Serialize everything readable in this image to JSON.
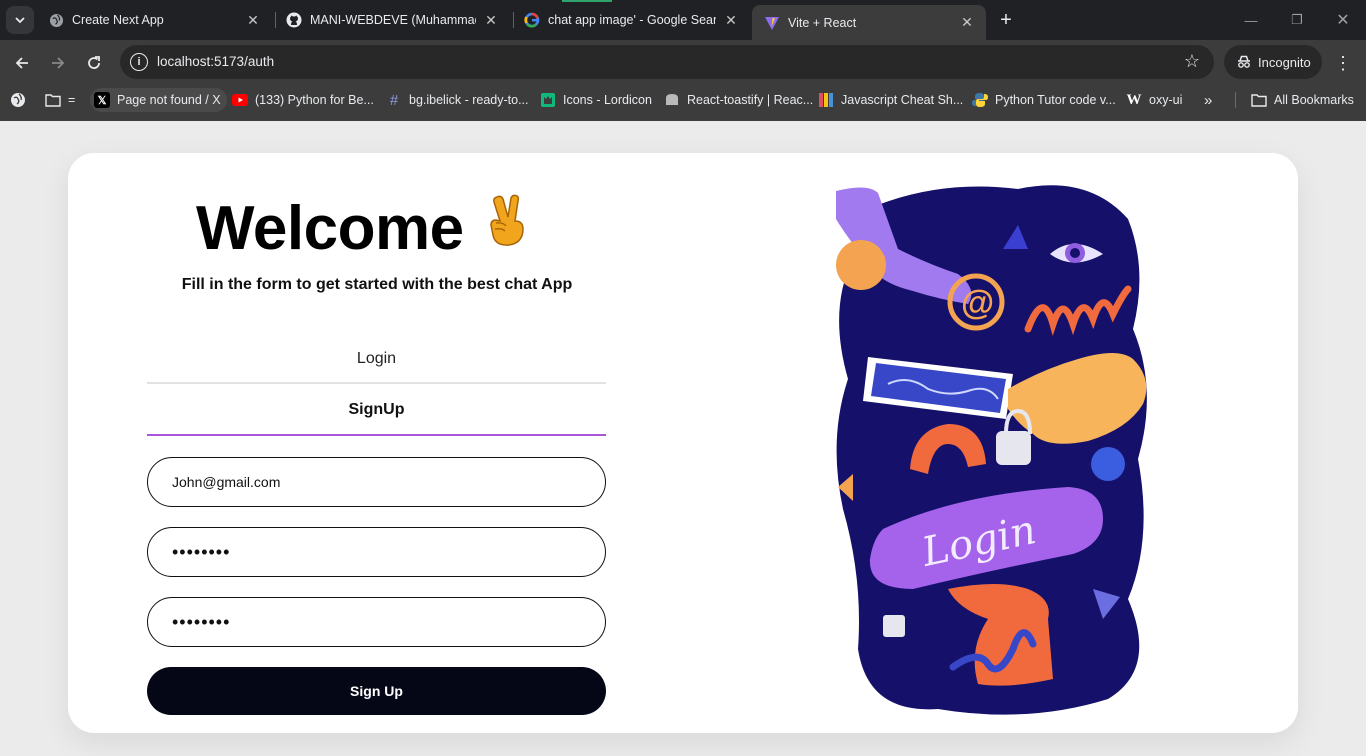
{
  "browser": {
    "tabs": [
      {
        "title": "Create Next App",
        "icon": "globe-icon"
      },
      {
        "title": "MANI-WEBDEVE (Muhammad I",
        "icon": "github-icon"
      },
      {
        "title": "chat app image' - Google Searc",
        "icon": "google-icon"
      },
      {
        "title": "Vite + React",
        "icon": "vite-icon",
        "active": true
      }
    ],
    "address": "localhost:5173/auth",
    "incognito_label": "Incognito",
    "bookmarks": [
      {
        "label": "Page not found / X",
        "icon": "x-icon"
      },
      {
        "label": "(133) Python for Be...",
        "icon": "youtube-icon"
      },
      {
        "label": "bg.ibelick - ready-to...",
        "icon": "hash-icon"
      },
      {
        "label": "Icons - Lordicon",
        "icon": "lordicon-icon"
      },
      {
        "label": "React-toastify | Reac...",
        "icon": "toastify-icon"
      },
      {
        "label": "Javascript Cheat Sh...",
        "icon": "cheatsheet-icon"
      },
      {
        "label": "Python Tutor code v...",
        "icon": "python-icon"
      },
      {
        "label": "oxy-ui",
        "icon": "w-icon"
      }
    ],
    "all_bookmarks_label": "All Bookmarks"
  },
  "auth": {
    "welcome": "Welcome",
    "subtitle": "Fill in the form to get started with the best chat App",
    "tabs": {
      "login": "Login",
      "signup": "SignUp"
    },
    "active_tab": "signup",
    "fields": {
      "email": "John@gmail.com",
      "password": "••••••••",
      "confirm_password": "••••••••"
    },
    "submit_label": "Sign Up",
    "illustration_text": "Login"
  },
  "colors": {
    "accent": "#a855d8",
    "button": "#050716",
    "illustration_bg": "#15106a"
  }
}
